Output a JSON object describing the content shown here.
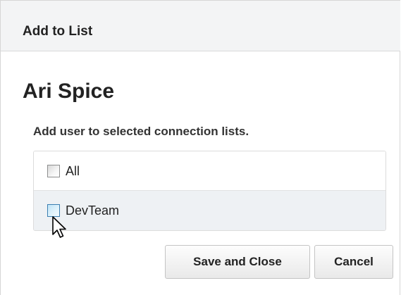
{
  "dialog": {
    "title": "Add to List",
    "user_name": "Ari Spice",
    "instructions": "Add user to selected connection lists.",
    "lists": [
      {
        "label": "All",
        "checked": false,
        "hovered": false
      },
      {
        "label": "DevTeam",
        "checked": false,
        "hovered": true
      }
    ],
    "buttons": {
      "save_label": "Save and Close",
      "cancel_label": "Cancel"
    }
  },
  "icons": {
    "cursor": "arrow-pointer-icon"
  },
  "colors": {
    "header_background": "#f3f4f5",
    "hover_row_background": "#eef1f4",
    "hover_checkbox_border": "#3c7fb1",
    "text": "#222222"
  }
}
